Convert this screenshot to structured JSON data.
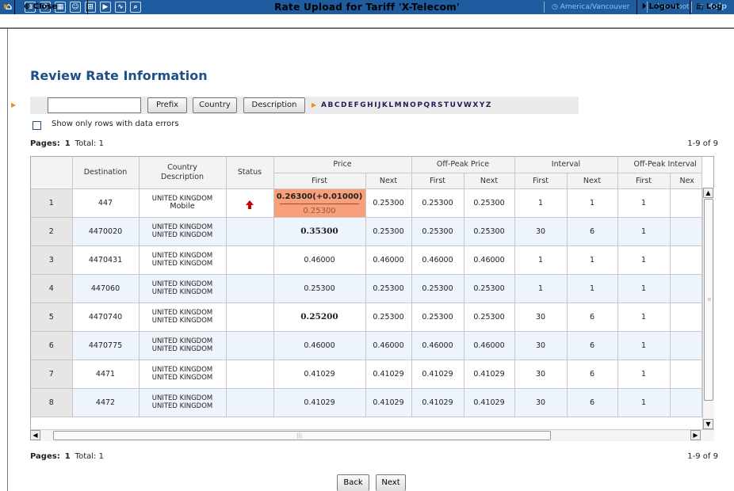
{
  "window": {
    "title": "Rate Upload for Tariff 'X-Telecom'",
    "timezone": "America/Vancouver",
    "user": "demoroot",
    "help_label": "Help"
  },
  "toolbar": {
    "close_label": "Close",
    "logout_label": "Logout",
    "log_label": "Log"
  },
  "page": {
    "title": "Review Rate Information"
  },
  "filter": {
    "input_value": "",
    "prefix_label": "Prefix",
    "country_label": "Country",
    "description_label": "Description",
    "letters": [
      "A",
      "B",
      "C",
      "D",
      "E",
      "F",
      "G",
      "H",
      "I",
      "J",
      "K",
      "L",
      "M",
      "N",
      "O",
      "P",
      "Q",
      "R",
      "S",
      "T",
      "U",
      "V",
      "W",
      "X",
      "Y",
      "Z"
    ]
  },
  "options": {
    "errors_only_label": "Show only rows with data errors",
    "errors_only_checked": false
  },
  "pagination": {
    "pages_label": "Pages:",
    "current_page": "1",
    "total_text": "Total: 1",
    "range_text": "1-9 of 9"
  },
  "table": {
    "headers": {
      "destination": "Destination",
      "country_description": "Country\nDescription",
      "status": "Status",
      "price": "Price",
      "offpeak_price": "Off-Peak Price",
      "interval": "Interval",
      "offpeak_interval": "Off-Peak Interval",
      "first": "First",
      "next": "Next",
      "next_truncated": "Nex"
    },
    "rows": [
      {
        "idx": "1",
        "destination": "447",
        "country": "UNITED KINGDOM",
        "description": "Mobile",
        "status": "price-increase-icon",
        "price_first_new": "0.26300(+0.01000)",
        "price_first_old": "0.25300",
        "price_next": "0.25300",
        "op_first": "0.25300",
        "op_next": "0.25300",
        "int_first": "1",
        "int_next": "1",
        "op_int_first": "1",
        "highlight": true
      },
      {
        "idx": "2",
        "destination": "4470020",
        "country": "UNITED KINGDOM",
        "description": "UNITED KINGDOM",
        "status": "",
        "price_first": "0.35300",
        "price_bold": true,
        "price_next": "0.25300",
        "op_first": "0.25300",
        "op_next": "0.25300",
        "int_first": "30",
        "int_next": "6",
        "op_int_first": "1"
      },
      {
        "idx": "3",
        "destination": "4470431",
        "country": "UNITED KINGDOM",
        "description": "UNITED KINGDOM",
        "status": "",
        "price_first": "0.46000",
        "price_next": "0.46000",
        "op_first": "0.46000",
        "op_next": "0.46000",
        "int_first": "1",
        "int_next": "1",
        "op_int_first": "1"
      },
      {
        "idx": "4",
        "destination": "447060",
        "country": "UNITED KINGDOM",
        "description": "UNITED KINGDOM",
        "status": "",
        "price_first": "0.25300",
        "price_next": "0.25300",
        "op_first": "0.25300",
        "op_next": "0.25300",
        "int_first": "1",
        "int_next": "1",
        "op_int_first": "1"
      },
      {
        "idx": "5",
        "destination": "4470740",
        "country": "UNITED KINGDOM",
        "description": "UNITED KINGDOM",
        "status": "",
        "price_first": "0.25200",
        "price_bold": true,
        "price_next": "0.25300",
        "op_first": "0.25300",
        "op_next": "0.25300",
        "int_first": "30",
        "int_next": "6",
        "op_int_first": "1"
      },
      {
        "idx": "6",
        "destination": "4470775",
        "country": "UNITED KINGDOM",
        "description": "UNITED KINGDOM",
        "status": "",
        "price_first": "0.46000",
        "price_next": "0.46000",
        "op_first": "0.46000",
        "op_next": "0.46000",
        "int_first": "30",
        "int_next": "6",
        "op_int_first": "1"
      },
      {
        "idx": "7",
        "destination": "4471",
        "country": "UNITED KINGDOM",
        "description": "UNITED KINGDOM",
        "status": "",
        "price_first": "0.41029",
        "price_next": "0.41029",
        "op_first": "0.41029",
        "op_next": "0.41029",
        "int_first": "30",
        "int_next": "6",
        "op_int_first": "1"
      },
      {
        "idx": "8",
        "destination": "4472",
        "country": "UNITED KINGDOM",
        "description": "UNITED KINGDOM",
        "status": "",
        "price_first": "0.41029",
        "price_next": "0.41029",
        "op_first": "0.41029",
        "op_next": "0.41029",
        "int_first": "30",
        "int_next": "6",
        "op_int_first": "1"
      }
    ]
  },
  "footer": {
    "back_label": "Back",
    "next_label": "Next"
  },
  "colors": {
    "topbar": "#1e5c9f",
    "title": "#1e5088",
    "highlight_cell": "#f7a07b",
    "accent_arrow": "#f08a14",
    "increase": "#c40000"
  }
}
